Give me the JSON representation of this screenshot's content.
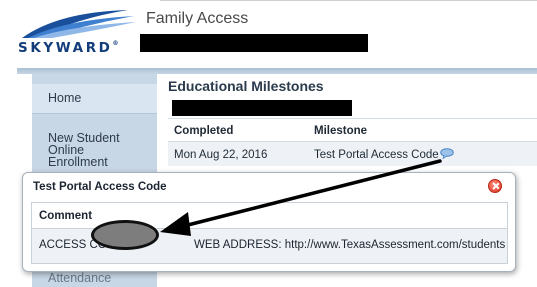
{
  "header": {
    "logo_text": "SKYWARD",
    "logo_sup": "®",
    "app_title": "Family Access"
  },
  "sidebar": {
    "items": [
      {
        "label": "Home"
      },
      {
        "label": "New Student\nOnline\nEnrollment"
      },
      {
        "label": "Attendance"
      }
    ]
  },
  "main": {
    "section_title": "Educational Milestones",
    "table": {
      "columns": [
        "Completed",
        "Milestone"
      ],
      "rows": [
        {
          "completed": "Mon Aug 22, 2016",
          "milestone": "Test Portal Access Code",
          "icon": "comment-bubble-icon"
        }
      ]
    }
  },
  "popup": {
    "title": "Test Portal Access Code",
    "column": "Comment",
    "comment_prefix": "ACCESS COD",
    "comment_suffix": "WEB ADDRESS: http://www.TexasAssessment.com/students"
  },
  "colors": {
    "brand_blue": "#123c7a",
    "sidebar_bg": "#c7d7e6",
    "row_bg": "#eef2f6",
    "close_red": "#d9311f"
  }
}
